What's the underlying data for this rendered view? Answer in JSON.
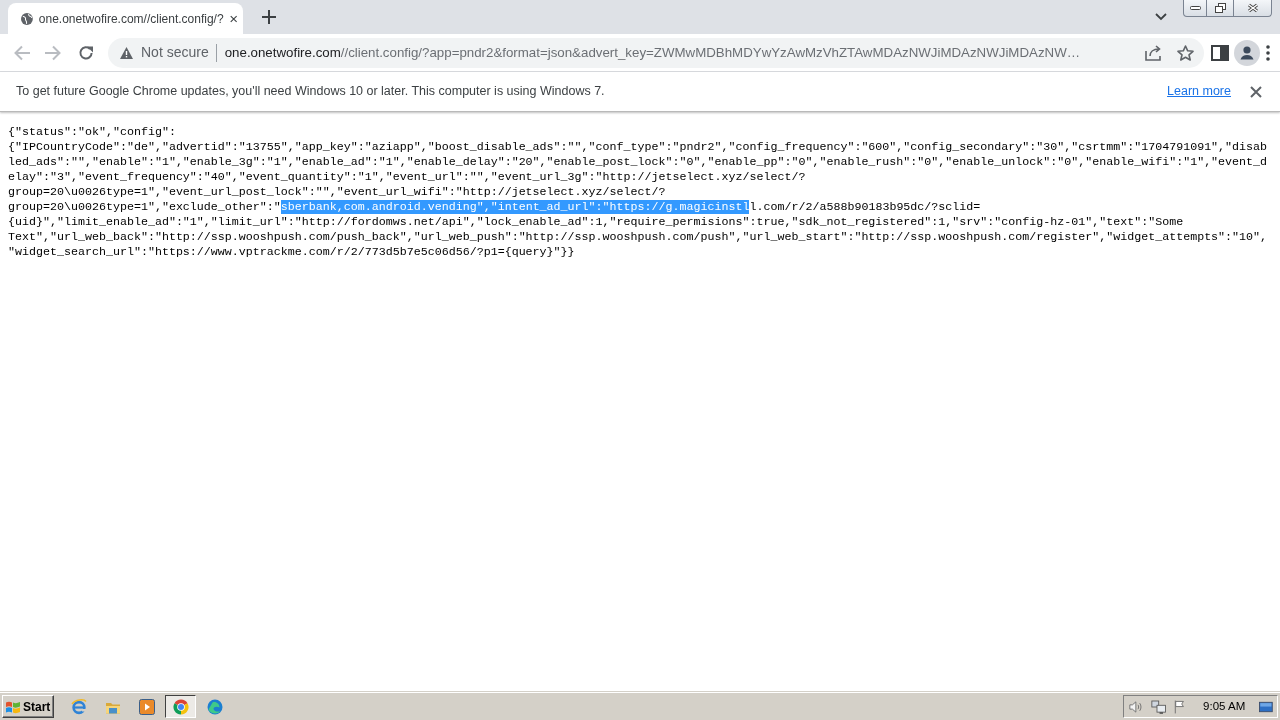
{
  "tabs": [
    {
      "title": "one.onetwofire.com//client.config/?",
      "selected": true
    }
  ],
  "toolbar": {
    "buttons": [
      {
        "kind": "back",
        "disabled": true
      },
      {
        "kind": "forward",
        "disabled": true
      },
      {
        "kind": "reload",
        "disabled": false
      }
    ]
  },
  "address_bar": {
    "security": "Not secure",
    "host": "one.onetwofire.com",
    "path": "//client.config/?app=pndr2&format=json&advert_key=ZWMwMDBhMDYwYzAwMzVhZTAwMDAzNWJiMDAzNWJiMDAzNW…"
  },
  "infobar": {
    "message": "To get future Google Chrome updates, you'll need Windows 10 or later. This computer is using Windows 7.",
    "link": "Learn more"
  },
  "page": {
    "lines": [
      {
        "spans": [
          {
            "text": "{\"status\":\"ok\",\"config\":",
            "selected": false
          }
        ]
      },
      {
        "spans": [
          {
            "text": "{\"IPCountryCode\":\"de\",\"advertid\":\"13755\",\"app_key\":\"aziapp\",\"boost_disable_ads\":\"\",\"conf_type\":\"pndr2\",\"config_frequency\":\"600\",\"config_secondary\":\"30\",\"csrtmm\":\"1704791091\",\"disab",
            "selected": false
          }
        ]
      },
      {
        "spans": [
          {
            "text": "led_ads\":\"\",\"enable\":\"1\",\"enable_3g\":\"1\",\"enable_ad\":\"1\",\"enable_delay\":\"20\",\"enable_post_lock\":\"0\",\"enable_pp\":\"0\",\"enable_rush\":\"0\",\"enable_unlock\":\"0\",\"enable_wifi\":\"1\",\"event_d",
            "selected": false
          }
        ]
      },
      {
        "spans": [
          {
            "text": "elay\":\"3\",\"event_frequency\":\"40\",\"event_quantity\":\"1\",\"event_url\":\"\",\"event_url_3g\":\"http://jetselect.xyz/select/?",
            "selected": false
          }
        ]
      },
      {
        "spans": [
          {
            "text": "group=20\\u0026type=1\",\"event_url_post_lock\":\"\",\"event_url_wifi\":\"http://jetselect.xyz/select/?",
            "selected": false
          }
        ]
      },
      {
        "spans": [
          {
            "text": "group=20\\u0026type=1\",\"exclude_other\":\"",
            "selected": false
          },
          {
            "text": "sberbank,com.android.vending\",\"intent_ad_url\":\"https://g.magicinstl",
            "selected": true
          },
          {
            "text": "l.com/r/2/a588b90183b95dc/?sclid=",
            "selected": false
          }
        ]
      },
      {
        "spans": [
          {
            "text": "{uid}\",\"limit_enable_ad\":\"1\",\"limit_url\":\"http://fordomws.net/api\",\"lock_enable_ad\":1,\"require_permisions\":true,\"sdk_not_registered\":1,\"srv\":\"config-hz-01\",\"text\":\"Some",
            "selected": false
          }
        ]
      },
      {
        "spans": [
          {
            "text": "Text\",\"url_web_back\":\"http://ssp.wooshpush.com/push_back\",\"url_web_push\":\"http://ssp.wooshpush.com/push\",\"url_web_start\":\"http://ssp.wooshpush.com/register\",\"widget_attempts\":\"10\",",
            "selected": false
          }
        ]
      },
      {
        "spans": [
          {
            "text": "\"widget_search_url\":\"https://www.vptrackme.com/r/2/773d5b7e5c06d56/?p1={query}\"}}",
            "selected": false
          }
        ]
      }
    ]
  },
  "taskbar": {
    "start": "Start",
    "apps": [
      {
        "kind": "e",
        "selected": false
      },
      {
        "kind": "folder",
        "selected": false
      },
      {
        "kind": "player",
        "selected": false
      },
      {
        "kind": "chrome",
        "selected": true
      },
      {
        "kind": "edge",
        "selected": false
      }
    ],
    "clock": "9:05 AM"
  }
}
